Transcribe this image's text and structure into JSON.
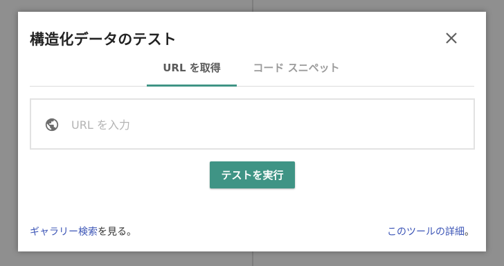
{
  "dialog": {
    "title": "構造化データのテスト",
    "close_icon": "close-icon"
  },
  "tabs": [
    {
      "label": "URL を取得",
      "active": true
    },
    {
      "label": "コード スニペット",
      "active": false
    }
  ],
  "url_input": {
    "placeholder": "URL を入力",
    "value": "",
    "icon": "globe-icon"
  },
  "run_button": {
    "label": "テストを実行"
  },
  "footer": {
    "left_link": "ギャラリー検索",
    "left_suffix": "を見る。",
    "right_link": "このツールの詳細",
    "right_suffix": "。"
  },
  "colors": {
    "accent": "#3f9485",
    "link": "#3b54b6",
    "backdrop": "#8f8f8f"
  }
}
